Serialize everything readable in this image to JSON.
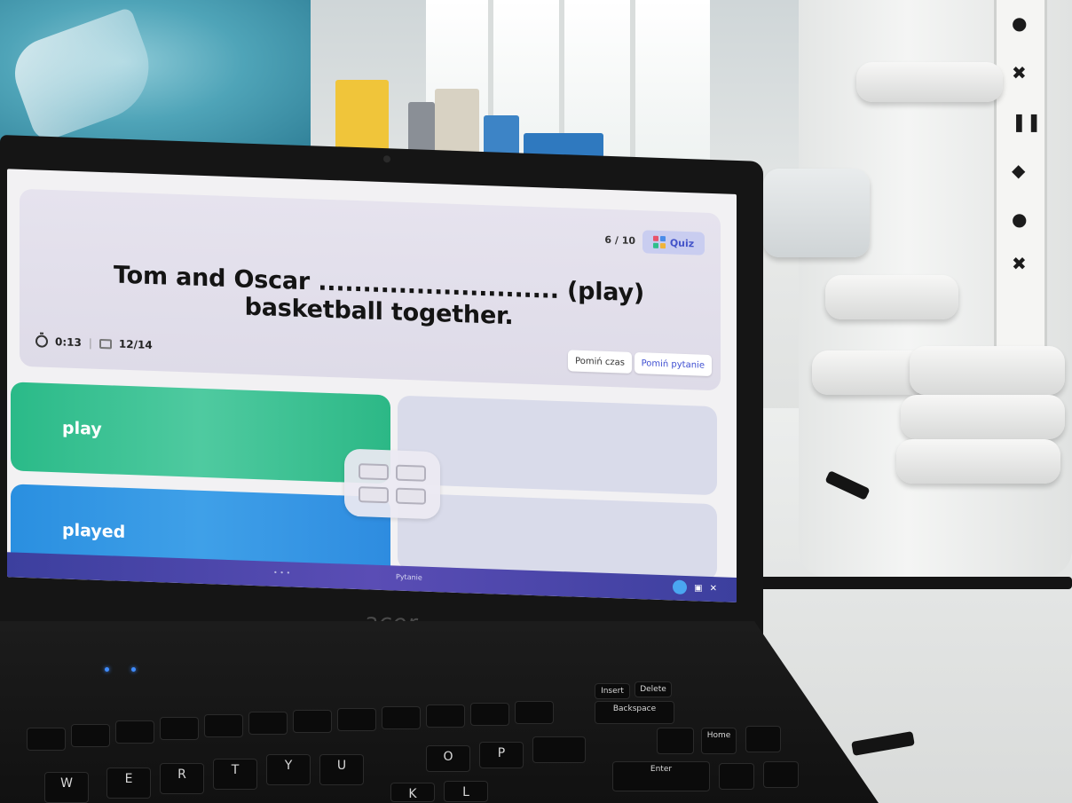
{
  "quiz": {
    "progress": "6 / 10",
    "tag_label": "Quiz",
    "question": "Tom and Oscar ........................... (play) basketball together.",
    "timer": "0:13",
    "cards": "12/14",
    "skip_time_label": "Pomiń czas",
    "skip_question_label": "Pomiń pytanie",
    "answers": [
      {
        "label": "play",
        "color": "#2aba88"
      },
      {
        "label": "played",
        "color": "#2a8fe0"
      }
    ]
  },
  "taskbar": {
    "window_title": "Pytanie",
    "dots": "• • •"
  },
  "laptop": {
    "brand": "acer"
  },
  "keyboard": {
    "keys": [
      "Backspace",
      "Enter",
      "W",
      "E",
      "R",
      "T",
      "Y",
      "U",
      "O",
      "P",
      "K",
      "L",
      "Home",
      "Insert",
      "Delete"
    ]
  },
  "colors": {
    "accent": "#4353c9",
    "green_answer": "#2aba88",
    "blue_answer": "#2a8fe0",
    "taskbar": "#3c3f9e"
  },
  "icons": {
    "timer": "timer-icon",
    "cards": "cards-icon",
    "quiz": "grid-icon"
  }
}
